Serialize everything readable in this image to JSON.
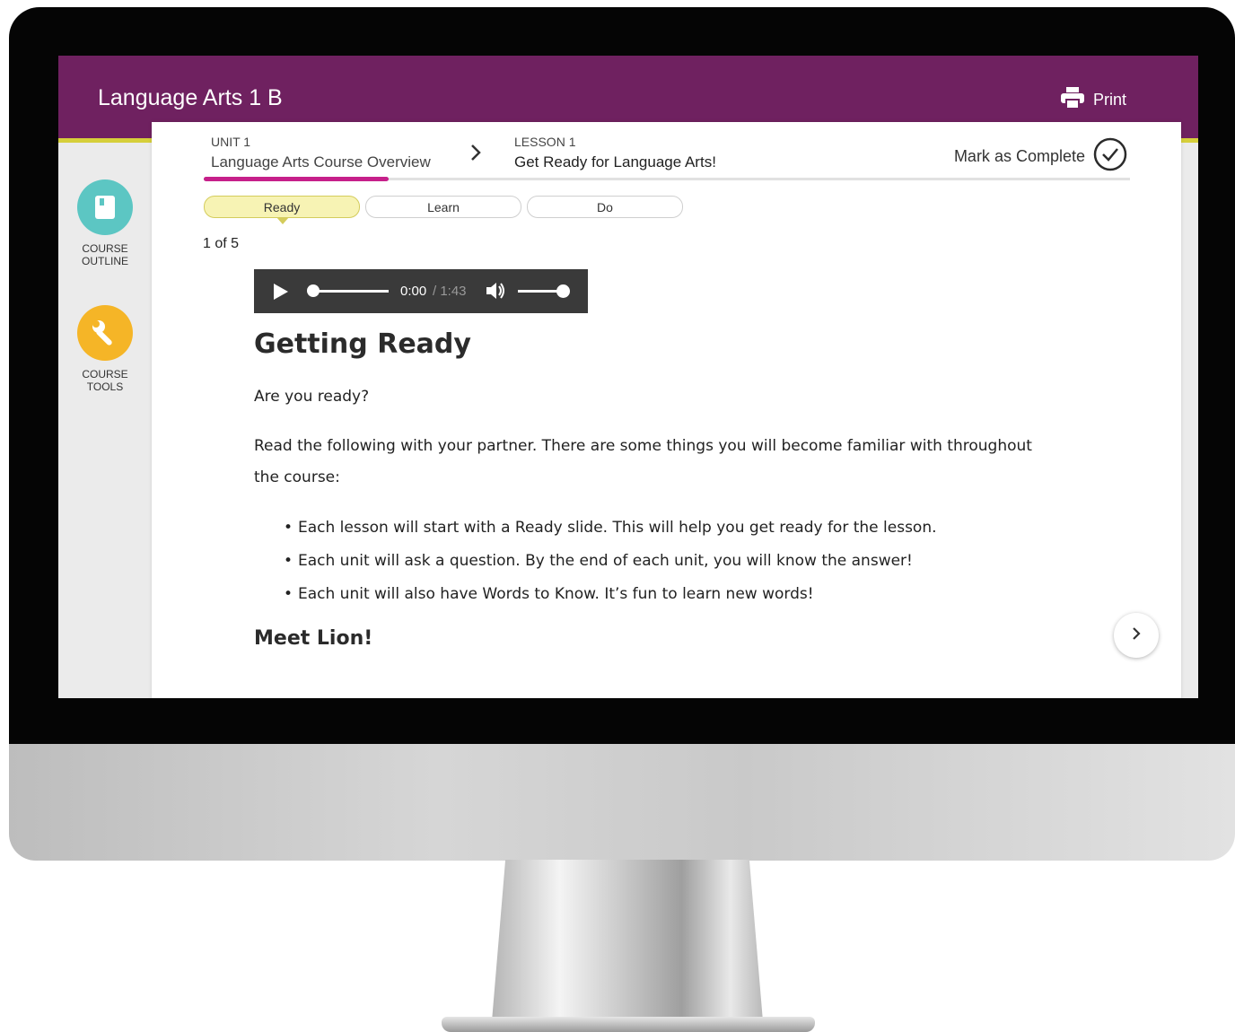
{
  "header": {
    "title": "Language Arts 1 B",
    "print_label": "Print"
  },
  "sidebar": {
    "items": [
      {
        "label_line1": "COURSE",
        "label_line2": "OUTLINE",
        "icon": "book-icon",
        "color": "#5cc6c3"
      },
      {
        "label_line1": "COURSE",
        "label_line2": "TOOLS",
        "icon": "wrench-icon",
        "color": "#f5b527"
      }
    ]
  },
  "breadcrumb": {
    "unit_label": "UNIT 1",
    "unit_title": "Language Arts Course Overview",
    "lesson_label": "LESSON 1",
    "lesson_title": "Get Ready for Language Arts!"
  },
  "progress": {
    "fraction": 0.2,
    "color": "#c6208a"
  },
  "mark_complete": {
    "label": "Mark as Complete"
  },
  "tabs": [
    {
      "label": "Ready",
      "active": true
    },
    {
      "label": "Learn",
      "active": false
    },
    {
      "label": "Do",
      "active": false
    }
  ],
  "counter": "1 of 5",
  "audio": {
    "current": "0:00",
    "duration": "/ 1:43"
  },
  "content": {
    "heading": "Getting Ready",
    "question": "Are you ready?",
    "intro": "Read the following with your partner. There are some things you will become familiar with throughout the course:",
    "bullets": [
      "Each lesson will start with a Ready slide. This will help you get ready for the lesson.",
      "Each unit will ask a question. By the end of each unit, you will know the answer!",
      "Each unit will also have Words to Know. It’s fun to learn new words!"
    ],
    "subheading": "Meet Lion!"
  },
  "colors": {
    "brand": "#6f2160",
    "accent": "#d6cf3b",
    "tab_active": "#f7f3b4"
  }
}
